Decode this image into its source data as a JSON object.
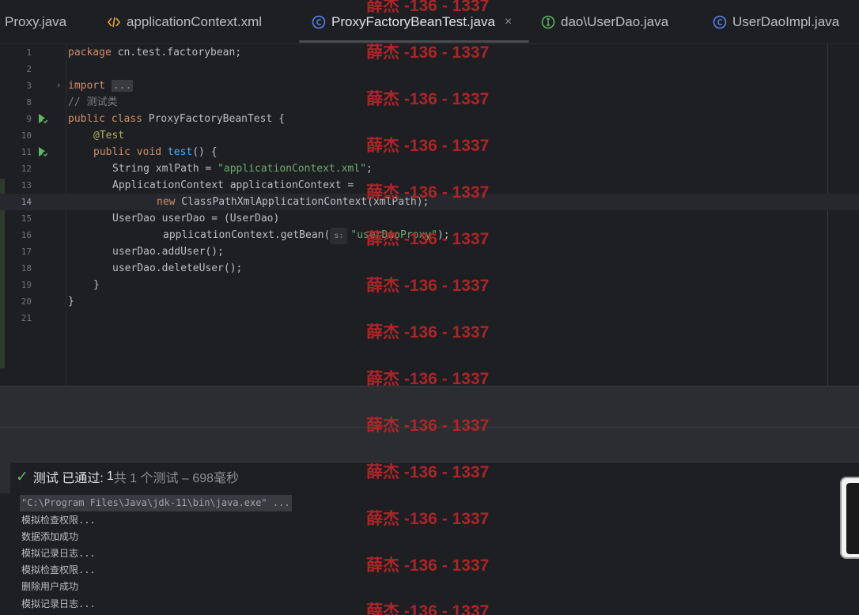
{
  "tabs": [
    {
      "label": "Proxy.java",
      "icon": "java-class-icon"
    },
    {
      "label": "applicationContext.xml",
      "icon": "xml-file-icon"
    },
    {
      "label": "ProxyFactoryBeanTest.java",
      "icon": "java-class-icon",
      "active": true
    },
    {
      "label": "dao\\UserDao.java",
      "icon": "java-interface-icon"
    },
    {
      "label": "UserDaoImpl.java",
      "icon": "java-class-icon"
    }
  ],
  "tab_close": "×",
  "line_numbers": [
    "1",
    "2",
    "3",
    "8",
    "9",
    "10",
    "11",
    "12",
    "13",
    "14",
    "15",
    "16",
    "17",
    "18",
    "19",
    "20",
    "21"
  ],
  "code": {
    "l1_kw": "package",
    "l1_rest": " cn.test.factorybean;",
    "l3_kw": "import",
    "l3_fold": "...",
    "l8_comment": "// 测试类",
    "l9_kw": "public class",
    "l9_rest": " ProxyFactoryBeanTest {",
    "l10_ann": "@Test",
    "l11_kw": "public void",
    "l11_fn": "test",
    "l11_rest": "() {",
    "l12_a": "String xmlPath = ",
    "l12_str": "\"applicationContext.xml\"",
    "l12_b": ";",
    "l13": "ApplicationContext applicationContext =",
    "l14_kw": "new",
    "l14_rest": " ClassPathXmlApplicationContext(xmlPath);",
    "l15": "UserDao userDao = (UserDao)",
    "l16_a": "applicationContext.getBean(",
    "l16_hint": "s:",
    "l16_str": "\"userDaoProxy\"",
    "l16_b": ");",
    "l17": "userDao.addUser();",
    "l18": "userDao.deleteUser();",
    "l19": "}",
    "l20": "}"
  },
  "test_result": {
    "check": "✓",
    "passed_label": "测试 已通过:",
    "passed_count": "1",
    "summary": "共 1 个测试 – 698毫秒"
  },
  "console_lines": [
    "\"C:\\Program Files\\Java\\jdk-11\\bin\\java.exe\" ...",
    "模拟检查权限...",
    "数据添加成功",
    "模拟记录日志...",
    "模拟检查权限...",
    "删除用户成功",
    "模拟记录日志..."
  ],
  "watermark": "薛杰 -136 - 1337",
  "colors": {
    "accent": "#56a8f5",
    "watermark": "#c0262a",
    "success": "#5fb865"
  }
}
